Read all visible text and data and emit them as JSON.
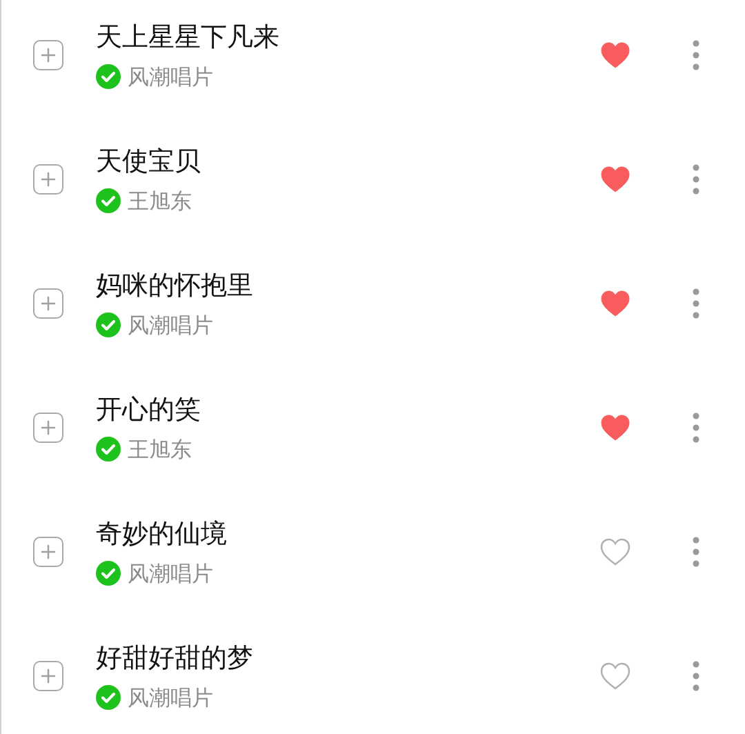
{
  "songs": [
    {
      "title": "天上星星下凡来",
      "artist": "风潮唱片",
      "verified": true,
      "liked": true
    },
    {
      "title": "天使宝贝",
      "artist": "王旭东",
      "verified": true,
      "liked": true
    },
    {
      "title": "妈咪的怀抱里",
      "artist": "风潮唱片",
      "verified": true,
      "liked": true
    },
    {
      "title": "开心的笑",
      "artist": "王旭东",
      "verified": true,
      "liked": true
    },
    {
      "title": "奇妙的仙境",
      "artist": "风潮唱片",
      "verified": true,
      "liked": false
    },
    {
      "title": "好甜好甜的梦",
      "artist": "风潮唱片",
      "verified": true,
      "liked": false
    }
  ]
}
